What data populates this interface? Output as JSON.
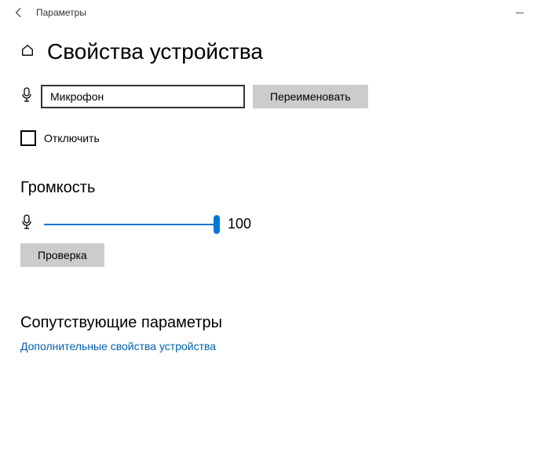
{
  "titlebar": {
    "app_title": "Параметры"
  },
  "header": {
    "title": "Свойства устройства"
  },
  "device": {
    "name_value": "Микрофон",
    "rename_label": "Переименовать"
  },
  "disable": {
    "label": "Отключить",
    "checked": false
  },
  "volume": {
    "section_label": "Громкость",
    "value": "100",
    "test_label": "Проверка"
  },
  "related": {
    "section_label": "Сопутствующие параметры",
    "link_text": "Дополнительные свойства устройства"
  }
}
